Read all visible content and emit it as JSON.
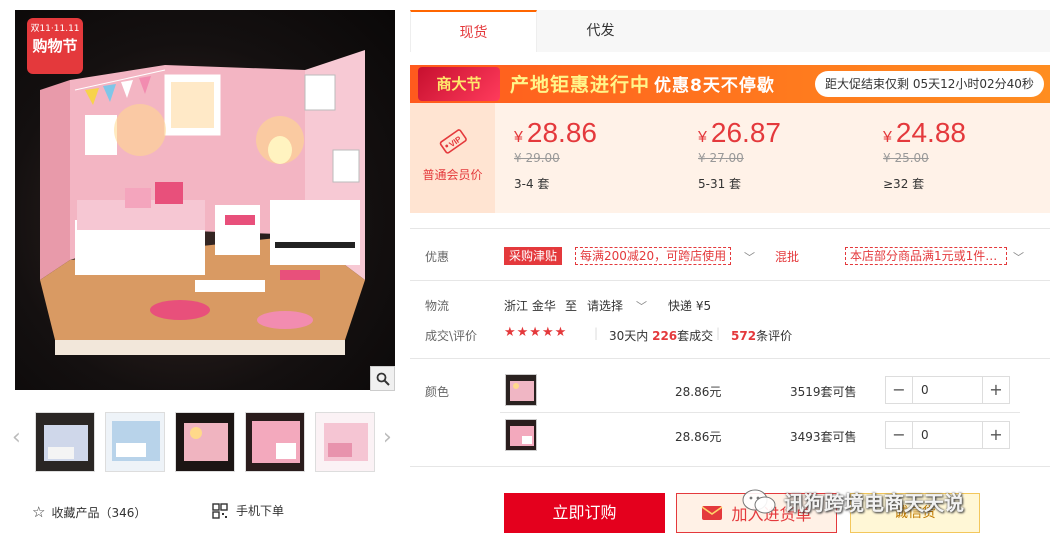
{
  "badge": {
    "top": "双11·11.11",
    "big": "购物节"
  },
  "gallery": {
    "favorite_label": "收藏产品（346）",
    "mobile_label": "手机下单"
  },
  "tabs": [
    {
      "label": "现货",
      "active": true
    },
    {
      "label": "代发",
      "active": false
    }
  ],
  "promo": {
    "logo": "商大节",
    "headline": "产地钜惠进行中",
    "sub": "优惠8天不停歇",
    "countdown": "距大促结束仅剩 05天12小时02分40秒"
  },
  "pricing": {
    "member_label": "普通会员价",
    "tiers": [
      {
        "price": "28.86",
        "old": "¥ 29.00",
        "qty": "3-4 套"
      },
      {
        "price": "26.87",
        "old": "¥ 27.00",
        "qty": "5-31 套"
      },
      {
        "price": "24.88",
        "old": "¥ 25.00",
        "qty": "≥32 套"
      }
    ],
    "currency": "¥"
  },
  "offers": {
    "label": "优惠",
    "tag1": "采购津贴",
    "coupon1": "每满200减20，可跨店使用",
    "tag2": "混批",
    "coupon2": "本店部分商品满1元或1件…"
  },
  "logistics": {
    "label": "物流",
    "from": "浙江 金华",
    "to_word": "至",
    "to_select": "请选择",
    "express": "快递 ¥5"
  },
  "deals": {
    "label": "成交\\评价",
    "stars": "★★★★★",
    "days_prefix": "30天内",
    "count": "226",
    "count_suffix": "套成交",
    "reviews": "572",
    "reviews_suffix": "条评价"
  },
  "sku": {
    "label": "颜色",
    "rows": [
      {
        "price": "28.86元",
        "stock": "3519套可售",
        "qty": "0"
      },
      {
        "price": "28.86元",
        "stock": "3493套可售",
        "qty": "0"
      }
    ]
  },
  "actions": {
    "buy": "立即订购",
    "cart": "加入进货单",
    "wholesale": "诚信贷"
  },
  "watermark": "讯狗跨境电商天天说",
  "colors": {
    "accent": "#e4393c",
    "orange": "#ff6a00"
  }
}
